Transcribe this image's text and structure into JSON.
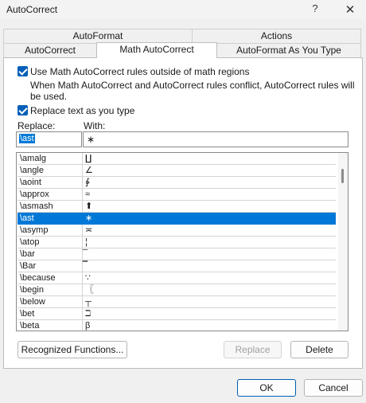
{
  "window": {
    "title": "AutoCorrect",
    "help_icon": "?",
    "close_icon": "✕"
  },
  "tabs_top": [
    {
      "label": "AutoFormat"
    },
    {
      "label": "Actions"
    }
  ],
  "tabs_bottom": [
    {
      "label": "AutoCorrect"
    },
    {
      "label": "Math AutoCorrect",
      "active": true
    },
    {
      "label": "AutoFormat As You Type"
    }
  ],
  "options": {
    "use_outside_label": "Use Math AutoCorrect rules outside of math regions",
    "use_outside_checked": true,
    "conflict_note": "When Math AutoCorrect and AutoCorrect rules conflict, AutoCorrect rules will be used.",
    "replace_as_you_type_label": "Replace text as you type",
    "replace_as_you_type_checked": true
  },
  "fields": {
    "replace_label": "Replace:",
    "with_label": "With:",
    "replace_value": "\\ast",
    "with_value": "∗"
  },
  "entries": [
    {
      "replace": "\\amalg",
      "with": "∐"
    },
    {
      "replace": "\\angle",
      "with": "∠"
    },
    {
      "replace": "\\aoint",
      "with": "∳"
    },
    {
      "replace": "\\approx",
      "with": "≈"
    },
    {
      "replace": "\\asmash",
      "with": "⬆"
    },
    {
      "replace": "\\ast",
      "with": "∗",
      "selected": true
    },
    {
      "replace": "\\asymp",
      "with": "≍"
    },
    {
      "replace": "\\atop",
      "with": "¦"
    },
    {
      "replace": "\\bar",
      "with": "̅"
    },
    {
      "replace": "\\Bar",
      "with": "̿"
    },
    {
      "replace": "\\because",
      "with": "∵"
    },
    {
      "replace": "\\begin",
      "with": "〖"
    },
    {
      "replace": "\\below",
      "with": "┬"
    },
    {
      "replace": "\\bet",
      "with": "ℶ"
    },
    {
      "replace": "\\beta",
      "with": "β"
    }
  ],
  "buttons": {
    "recognized_functions": "Recognized Functions...",
    "replace": "Replace",
    "delete": "Delete",
    "ok": "OK",
    "cancel": "Cancel"
  },
  "colors": {
    "accent": "#0078d7",
    "checkbox": "#005fb8"
  }
}
